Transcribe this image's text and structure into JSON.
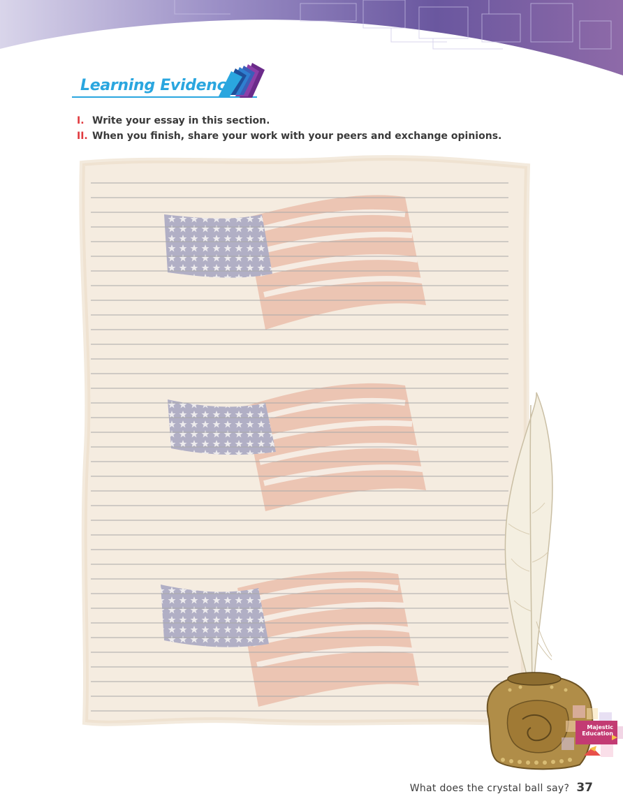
{
  "header": {
    "title": "Learning Evidence"
  },
  "instructions": [
    {
      "number": "I.",
      "text": "Write your essay in this section."
    },
    {
      "number": "II.",
      "text": "When you finish, share your work with your peers and exchange opinions."
    }
  ],
  "writing_area": {
    "line_count": 37
  },
  "logo": {
    "line1": "Majestic",
    "line2": "Education"
  },
  "footer": {
    "text": "What does the crystal ball say?",
    "page_number": "37"
  },
  "colors": {
    "accent_blue": "#2aa6df",
    "number_red": "#e0393e",
    "banner_purple": "#6d5aa0",
    "paper": "#f5ece0"
  }
}
